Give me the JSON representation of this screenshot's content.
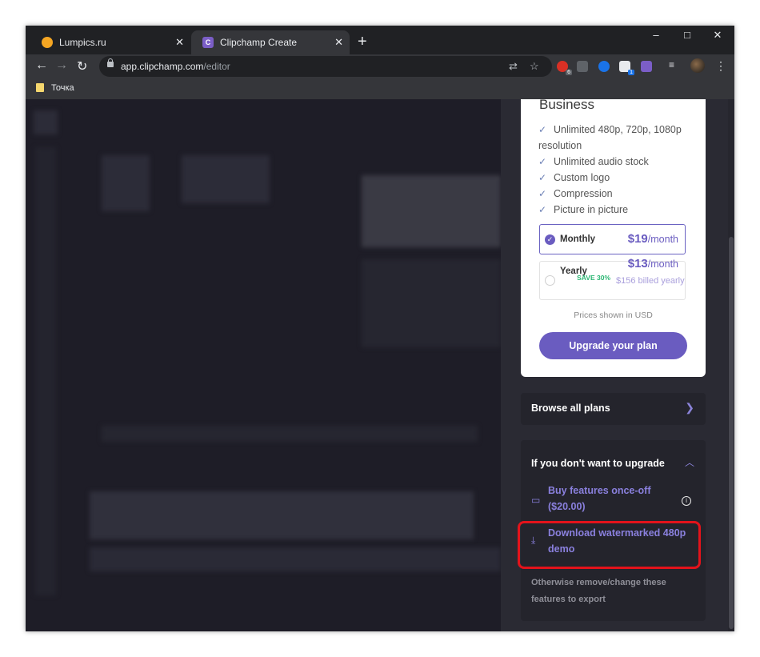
{
  "browser": {
    "tabs": [
      {
        "title": "Lumpics.ru",
        "active": false
      },
      {
        "title": "Clipchamp Create",
        "active": true
      }
    ],
    "new_tab": "+",
    "url_host": "app.clipchamp.com",
    "url_path": "/editor",
    "bookmark": "Точка",
    "window_controls": {
      "minimize": "–",
      "maximize": "□",
      "close": "✕"
    }
  },
  "plan": {
    "title": "Business",
    "features": [
      "Unlimited 480p, 720p, 1080p resolution",
      "Unlimited audio stock",
      "Custom logo",
      "Compression",
      "Picture in picture"
    ],
    "monthly": {
      "label": "Monthly",
      "price": "$19",
      "per": "/month",
      "selected": true
    },
    "yearly": {
      "label": "Yearly",
      "save": "SAVE 30%",
      "price": "$13",
      "per": "/month",
      "billed": "$156 billed yearly",
      "selected": false
    },
    "prices_note": "Prices shown in USD",
    "upgrade_button": "Upgrade your plan"
  },
  "browse": {
    "label": "Browse all plans"
  },
  "no_upgrade": {
    "title": "If you don't want to upgrade",
    "buy_once": "Buy features once-off ($20.00)",
    "download_demo": "Download watermarked 480p demo",
    "note": "Otherwise remove/change these features to export"
  },
  "colors": {
    "accent": "#6a5cc0",
    "highlight": "#e3131b",
    "panel_bg": "#2a2a33"
  }
}
